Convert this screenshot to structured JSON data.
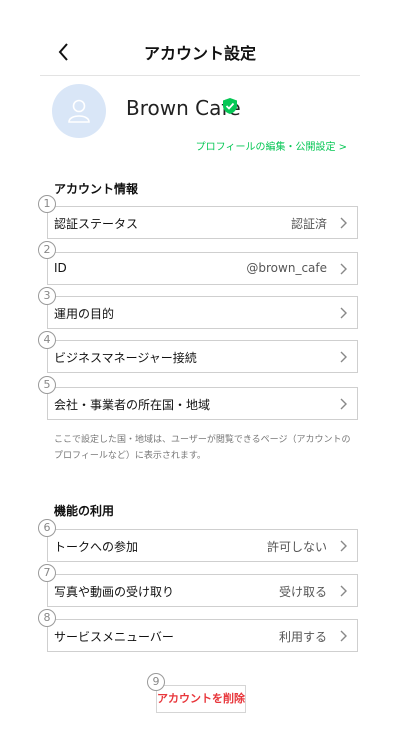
{
  "header": {
    "title": "アカウント設定"
  },
  "profile": {
    "name": "Brown Cafe",
    "edit_link": "プロフィールの編集・公開設定 >"
  },
  "account_info": {
    "title": "アカウント情報",
    "rows": [
      {
        "num": "1",
        "label": "認証ステータス",
        "value": "認証済"
      },
      {
        "num": "2",
        "label": "ID",
        "value": "@brown_cafe"
      },
      {
        "num": "3",
        "label": "運用の目的",
        "value": ""
      },
      {
        "num": "4",
        "label": "ビジネスマネージャー接続",
        "value": ""
      },
      {
        "num": "5",
        "label": "会社・事業者の所在国・地域",
        "value": ""
      }
    ],
    "note": "ここで設定した国・地域は、ユーザーが閲覧できるページ（アカウントのプロフィールなど）に表示されます。"
  },
  "features": {
    "title": "機能の利用",
    "rows": [
      {
        "num": "6",
        "label": "トークへの参加",
        "value": "許可しない"
      },
      {
        "num": "7",
        "label": "写真や動画の受け取り",
        "value": "受け取る"
      },
      {
        "num": "8",
        "label": "サービスメニューバー",
        "value": "利用する"
      }
    ]
  },
  "delete": {
    "num": "9",
    "label": "アカウントを削除"
  },
  "colors": {
    "accent": "#06c755",
    "danger": "#e8363b",
    "avatar_bg": "#d9e6f7"
  }
}
